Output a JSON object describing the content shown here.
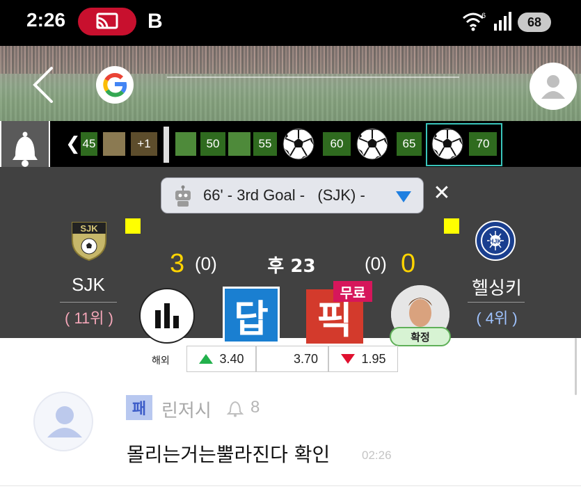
{
  "status_bar": {
    "time": "2:26",
    "cast_icon": "screen-cast-icon",
    "b_label": "B",
    "wifi_superscript": "6",
    "battery": "68"
  },
  "header": {
    "back_icon": "chevron-left-icon",
    "google_icon": "google-g-icon",
    "profile_icon": "user-icon"
  },
  "timeline": {
    "chevron": "❮",
    "items": [
      {
        "label": "45",
        "type": "minute"
      },
      {
        "label": "",
        "type": "event"
      },
      {
        "label": "+1",
        "type": "extra"
      },
      {
        "label": "",
        "type": "event"
      },
      {
        "label": "50",
        "type": "minute"
      },
      {
        "label": "",
        "type": "event"
      },
      {
        "label": "55",
        "type": "minute"
      },
      {
        "label": "60",
        "type": "minute"
      },
      {
        "label": "65",
        "type": "minute"
      },
      {
        "label": "70",
        "type": "minute"
      }
    ]
  },
  "match": {
    "goal_event": "66' - 3rd Goal -   (SJK) -",
    "home": {
      "name": "SJK",
      "rank": "( 11위 )",
      "score": "3",
      "half_score": "(0)"
    },
    "away": {
      "name": "헬싱키",
      "rank": "( 4위 )",
      "score": "0",
      "half_score": "(0)"
    },
    "time": "후 23",
    "buttons": {
      "dap": "답",
      "pick": "픽",
      "free_badge": "무료",
      "confirm": "확정"
    }
  },
  "odds": {
    "label": "해외",
    "home": "3.40",
    "draw": "3.70",
    "away": "1.95",
    "up_color": "#22b14c",
    "down_color": "#e0102f"
  },
  "comment": {
    "level": "패",
    "user": "린저시",
    "like_count": "8",
    "text": "몰리는거는뿔라진다 확인",
    "time": "02:26"
  },
  "colors": {
    "score_yellow": "#ffd400",
    "panel": "#414141",
    "timeline_green": "#2f6b1f",
    "selected_border": "#39c5bb"
  }
}
